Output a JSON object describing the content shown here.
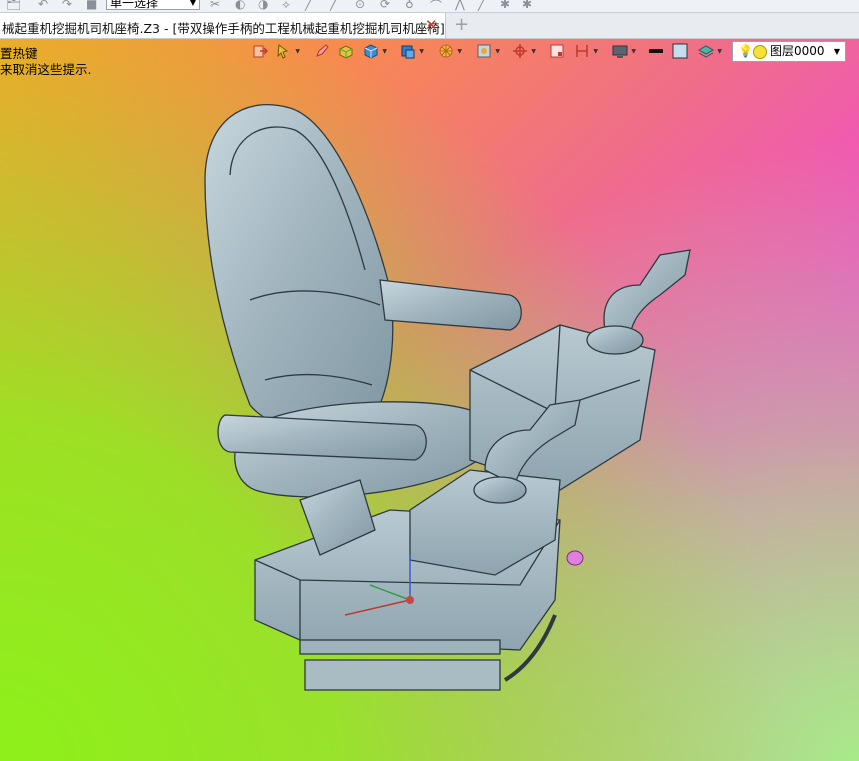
{
  "top_strip": {
    "select_mode": "单一选择"
  },
  "tab": {
    "title": "械起重机挖掘机司机座椅.Z3 - [带双操作手柄的工程机械起重机挖掘机司机座椅]",
    "close_icon": "close-icon",
    "new_tab_icon": "plus-icon"
  },
  "viewport": {
    "hint_line1": "置热键",
    "hint_line2": "来取消这些提示.",
    "background_colors": [
      "#f7a42a",
      "#f04fc8",
      "#8ef01a",
      "#a8ea8a"
    ]
  },
  "toolbar": {
    "layer_name": "图层0000",
    "icons": [
      "exit-icon",
      "select-filter-icon",
      "pen-icon",
      "solid-yellow-icon",
      "cube-icon",
      "view-cube-icon",
      "sun-render-icon",
      "frame-icon",
      "target-icon",
      "rectangle-icon",
      "dimension-icon",
      "monitor-icon",
      "line-style-icon",
      "color-swatch-icon",
      "layers-icon",
      "bulb-icon"
    ]
  },
  "model": {
    "description_color": "#9fb3bd",
    "triad_axes": [
      "x-axis",
      "y-axis",
      "z-axis"
    ]
  }
}
